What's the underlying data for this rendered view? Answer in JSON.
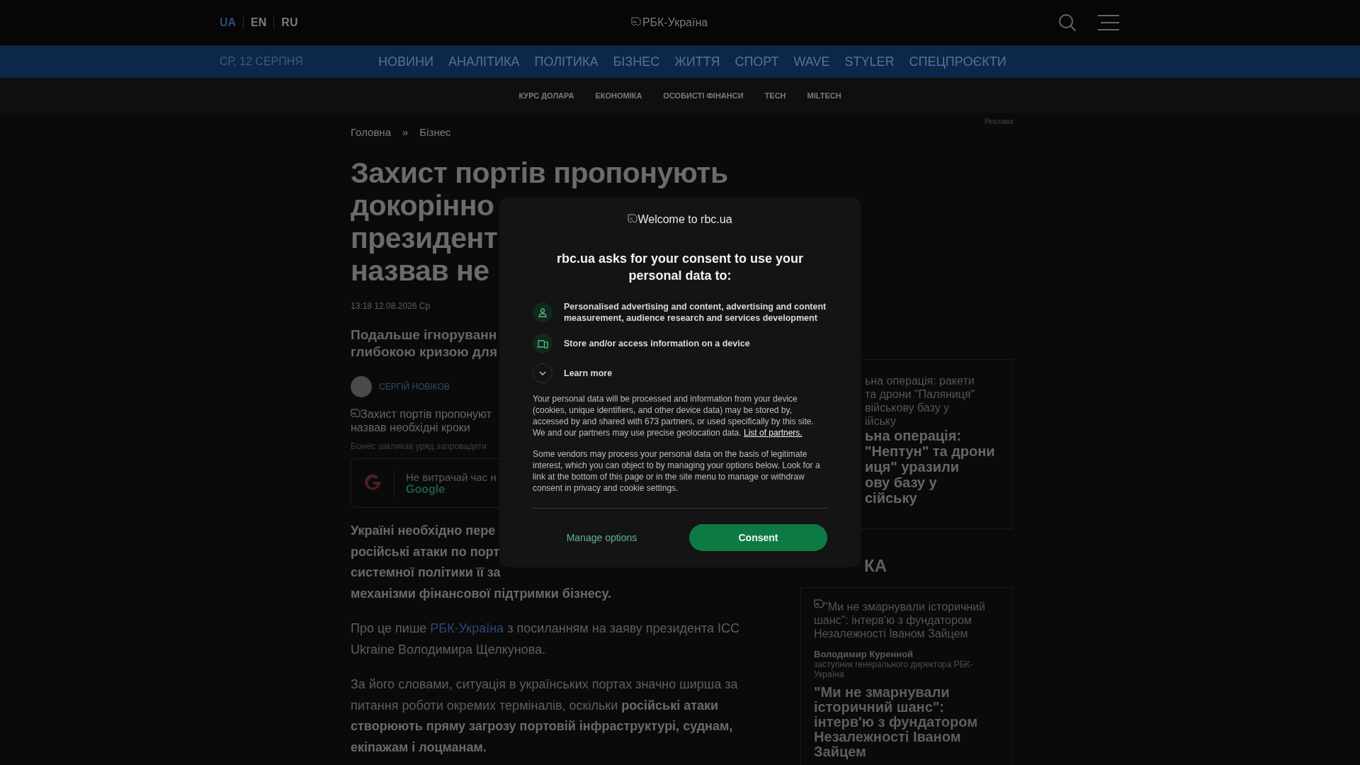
{
  "header": {
    "languages": [
      {
        "label": "UA",
        "selected": true
      },
      {
        "label": "EN",
        "selected": false
      },
      {
        "label": "RU",
        "selected": false
      }
    ],
    "logo_alt": "РБК-Україна"
  },
  "nav": {
    "date": "СР, 12 СЕРПНЯ",
    "items": [
      "НОВИНИ",
      "АНАЛІТИКА",
      "ПОЛІТИКА",
      "БІЗНЕС",
      "ЖИТТЯ",
      "СПОРТ",
      "WAVE",
      "STYLER",
      "СПЕЦПРОЄКТИ"
    ]
  },
  "subnav": [
    "КУРС ДОЛАРА",
    "ЕКОНОМІКА",
    "ОСОБИСТІ ФІНАНСИ",
    "TECH",
    "MILTECH"
  ],
  "ad_label": "Реклама",
  "breadcrumbs": {
    "items": [
      "Головна",
      "Бізнес"
    ],
    "separator": "»"
  },
  "article": {
    "title_lines": [
      "Захист портів пропонують",
      "докорінно",
      "президент",
      "назвав не"
    ],
    "datetime": "13:18 12.08.2026 Ср",
    "lead_lines": [
      "Подальше ігноруванн",
      "глибокою кризою для"
    ],
    "author": "СЕРГІЙ НОВІКОВ",
    "image_alt_lines": [
      "Захист портів пропонуют",
      "назвав необхідні кроки"
    ],
    "caption": "Бізнес закликав уряд запровадити",
    "google_promo": {
      "text": "Не витрачай час н",
      "link": "Google"
    },
    "bold_lines": [
      "Україні необхідно пере",
      "російські атаки по порт",
      "системної політики її за",
      "механізми фінансової підтримки бізнесу."
    ],
    "source_paragraph": {
      "before": "Про це пише ",
      "link": "РБК-Україна",
      "after": " з посиланням на заяву президента ICC Ukraine Володимира Щелкунова."
    },
    "quote_paragraph": "За його словами, ситуація в українських портах значно ширша за питання роботи окремих терміналів, оскільки **російські атаки створюють пряму загрозу портовій інфраструктурі, суднам, екіпажам і лоцманам.**"
  },
  "sidebar": {
    "card": {
      "alt_lines": [
        "ьна операція: ракети",
        "та дрони \"Паляниця\"",
        "військову базу у",
        "ійську"
      ],
      "title_lines": [
        "ьна операція:",
        "\"Нептун\" та дрони",
        "иця\" уразили",
        "ову базу у",
        "сійську"
      ]
    },
    "section_heading": "КА",
    "opinion": {
      "alt": "\"Ми не змарнували історичний шанс\": інтерв'ю з фундатором Незалежності Іваном Зайцем",
      "author": "Володимир Куренной",
      "role": "заступник генерального директора РБК-Україна",
      "title": "\"Ми не змарнували історичний шанс\": інтерв'ю з фундатором Незалежності Іваном Зайцем"
    }
  },
  "consent": {
    "logo_alt": "Welcome to rbc.ua",
    "heading": "rbc.ua asks for your consent to use your personal data to:",
    "purposes": [
      {
        "kind": "person",
        "text": "Personalised advertising and content, advertising and content measurement, audience research and services development"
      },
      {
        "kind": "device",
        "text": "Store and/or access information on a device"
      }
    ],
    "learn_more": "Learn more",
    "notice": {
      "text": "Your personal data will be processed and information from your device (cookies, unique identifiers, and other device data) may be stored by, accessed by and shared with 673 partners, or used specifically by this site. We and our partners may use precise geolocation data. ",
      "link": "List of partners."
    },
    "legitimate_interest": "Some vendors may process your personal data on the basis of legitimate interest, which you can object to by managing your options below. Look for a link at the bottom of this page or in the site menu to manage or withdraw consent in privacy and cookie settings.",
    "buttons": {
      "manage": "Manage options",
      "consent": "Consent"
    }
  }
}
